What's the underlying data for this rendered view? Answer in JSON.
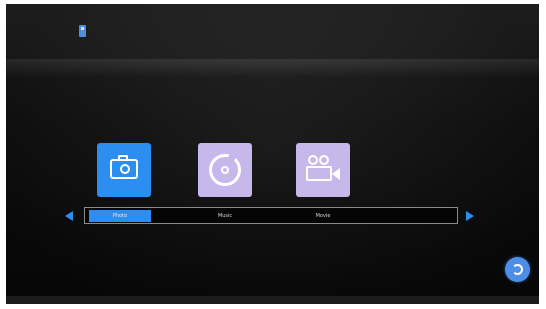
{
  "menu": {
    "items": [
      {
        "label": "Photo",
        "icon": "camera-icon",
        "active": true
      },
      {
        "label": "Music",
        "icon": "music-disc-icon",
        "active": false
      },
      {
        "label": "Movie",
        "icon": "movie-camera-icon",
        "active": false
      }
    ]
  },
  "status": {
    "usb_icon": "usb-icon"
  },
  "navigation": {
    "left_icon": "left-arrow-icon",
    "right_icon": "right-arrow-icon",
    "return_icon": "return-icon"
  },
  "colors": {
    "accent": "#2b8ef0",
    "tile_inactive": "#c7b8ec",
    "background": "#141414"
  }
}
